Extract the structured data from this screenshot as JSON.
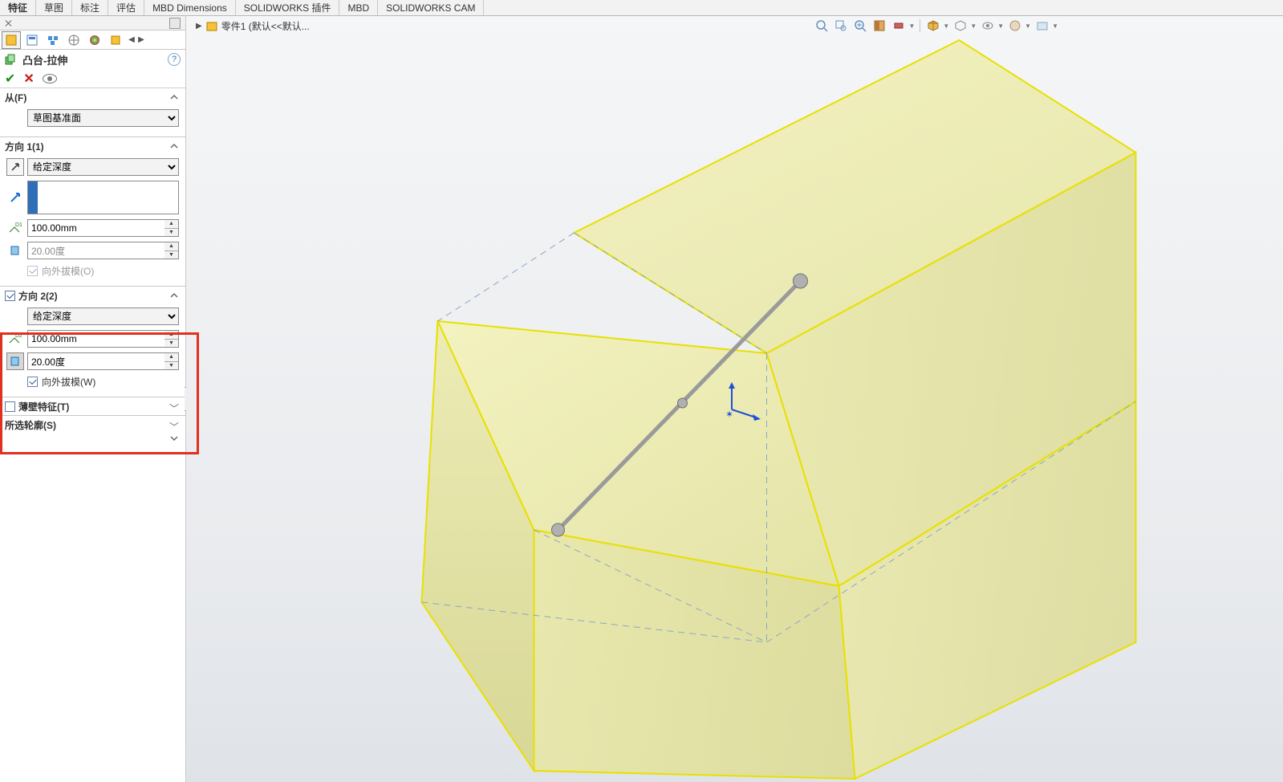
{
  "ribbon": {
    "tabs": [
      "特征",
      "草图",
      "标注",
      "评估",
      "MBD Dimensions",
      "SOLIDWORKS 插件",
      "MBD",
      "SOLIDWORKS CAM"
    ]
  },
  "panel": {
    "feature_title": "凸台-拉伸",
    "from": {
      "label": "从(F)",
      "option": "草图基准面"
    },
    "dir1": {
      "label": "方向 1(1)",
      "type_option": "给定深度",
      "depth": "100.00mm",
      "draft": "20.00度",
      "draft_out_label": "向外拔模(O)",
      "draft_out_checked": true,
      "draft_out_enabled": false
    },
    "dir2": {
      "enabled": true,
      "label": "方向 2(2)",
      "type_option": "给定深度",
      "depth": "100.00mm",
      "draft": "20.00度",
      "draft_out_label": "向外拔模(W)",
      "draft_out_checked": true
    },
    "thin": {
      "enabled": false,
      "label": "薄壁特征(T)"
    },
    "contours": {
      "label": "所选轮廓(S)"
    }
  },
  "viewport": {
    "breadcrumb": "零件1  (默认<<默认..."
  }
}
